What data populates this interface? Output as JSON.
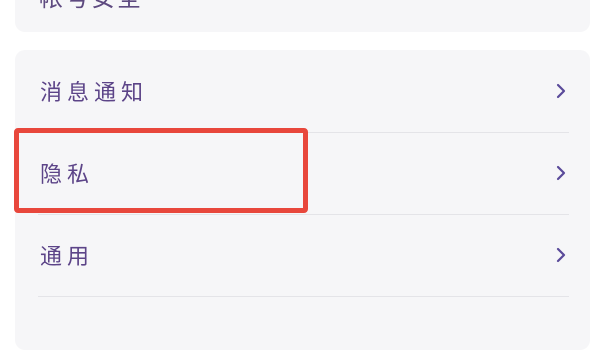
{
  "top_section": {
    "partial_label": "帐号安全"
  },
  "settings_list": {
    "items": [
      {
        "label": "消息通知",
        "icon": "chevron-right-icon"
      },
      {
        "label": "隐私",
        "icon": "chevron-right-icon"
      },
      {
        "label": "通用",
        "icon": "chevron-right-icon"
      }
    ]
  },
  "colors": {
    "text": "#5c4488",
    "chevron": "#5a4a9a",
    "card_background": "#f6f6f8",
    "highlight": "#e8473c"
  }
}
